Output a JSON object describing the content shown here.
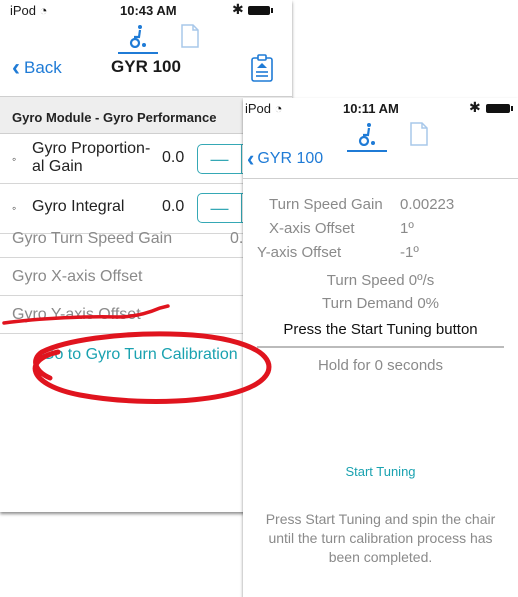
{
  "colors": {
    "ios_blue": "#1f7bd6",
    "teal": "#1aa2b0",
    "annotation_red": "#e0141e"
  },
  "left_screen": {
    "status": {
      "carrier": "iPod ◔",
      "time": "10:43 AM",
      "bluetooth": "✱"
    },
    "nav": {
      "back_label": "Back",
      "title": "GYR 100"
    },
    "icons": [
      "wheelchair-icon",
      "document-icon",
      "clipboard-icon"
    ],
    "section_header": "Gyro Module - Gyro Performance",
    "params": [
      {
        "label": "Gyro Proportion- al Gain",
        "value": "0.0"
      },
      {
        "label": "Gyro Integral",
        "value": "0.0"
      }
    ],
    "info_rows": [
      {
        "label": "Gyro Turn Speed Gain",
        "value": "0."
      },
      {
        "label": "Gyro X-axis Offset",
        "value": ""
      },
      {
        "label": "Gyro Y-axis Offset",
        "value": ""
      }
    ],
    "calibration_link": "Go to Gyro Turn Calibration"
  },
  "right_screen": {
    "status": {
      "carrier": "iPod ◔",
      "time": "10:11 AM",
      "bluetooth": "✱"
    },
    "nav": {
      "back_label": "GYR 100"
    },
    "values": [
      {
        "label": "Turn Speed Gain",
        "value": "0.00223"
      },
      {
        "label": "X-axis Offset",
        "value": "1º"
      },
      {
        "label": "Y-axis Offset",
        "value": "-1º"
      }
    ],
    "turn_speed": "Turn Speed 0º/s",
    "turn_demand": "Turn Demand 0%",
    "tuning_prompt": "Press the Start Tuning button",
    "hold_text": "Hold for 0 seconds",
    "start_button": "Start Tuning",
    "instructions": "Press Start Tuning and spin the chair until the turn calibration process has been completed."
  }
}
